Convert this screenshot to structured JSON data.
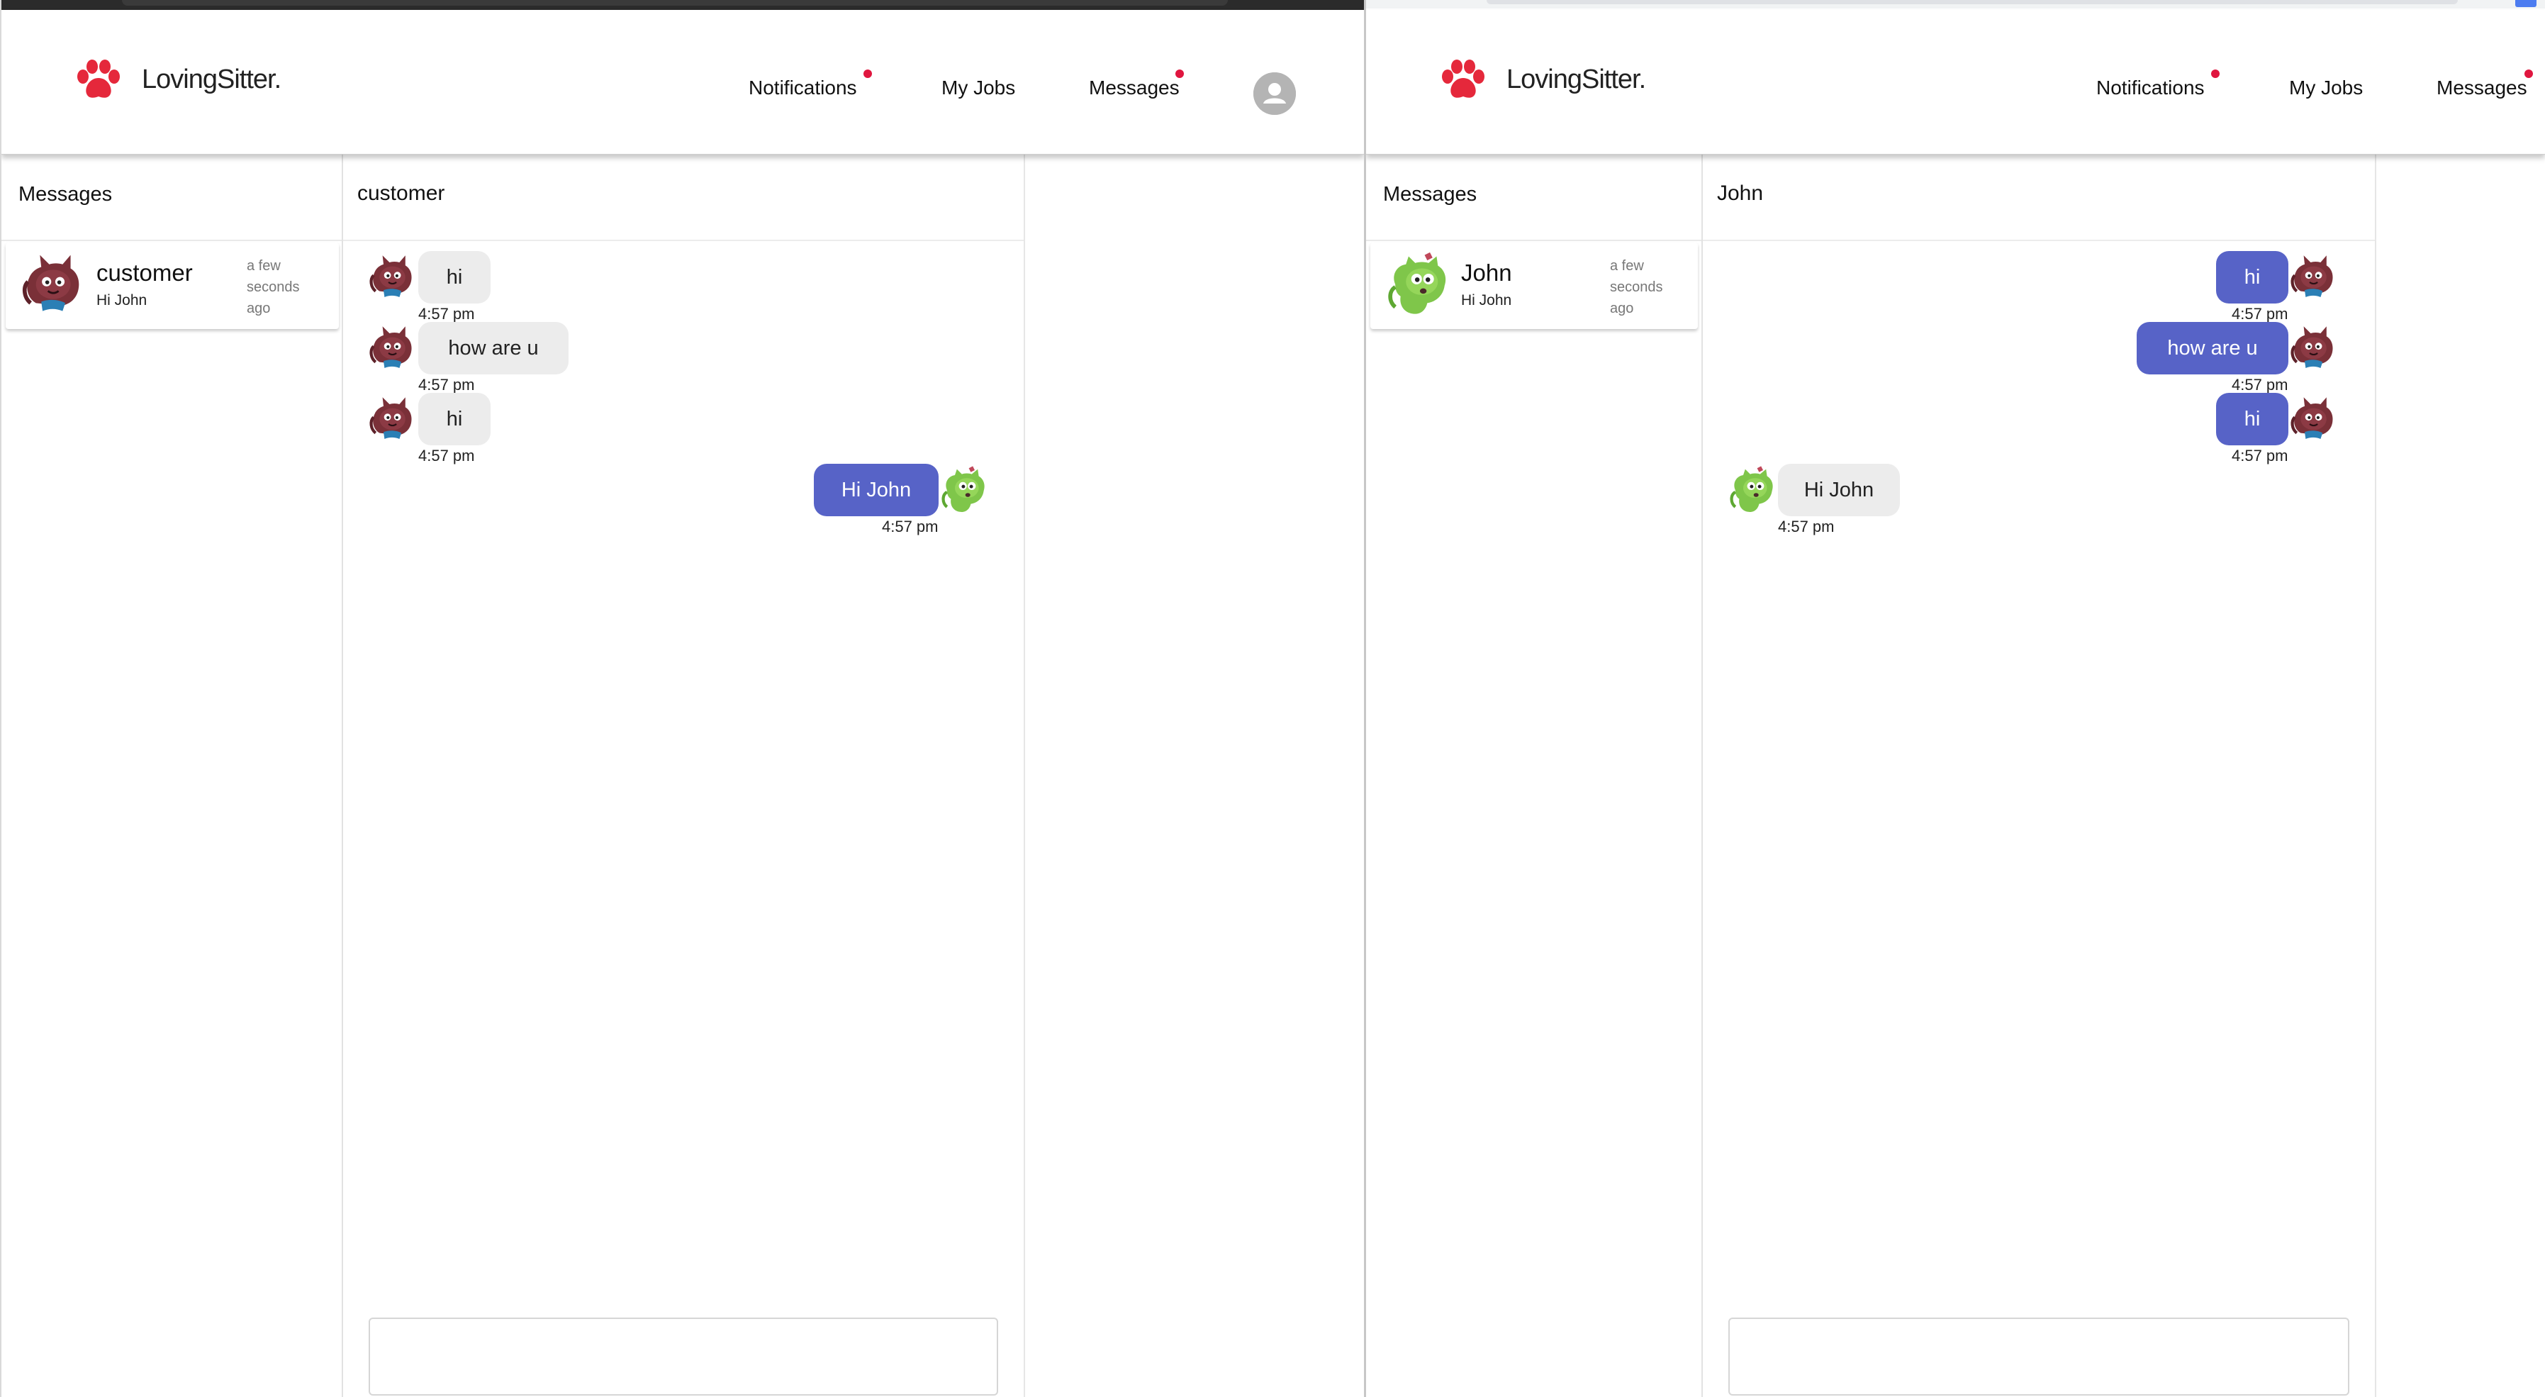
{
  "left_window": {
    "brand": "LovingSitter.",
    "nav": {
      "notifications": "Notifications",
      "my_jobs": "My Jobs",
      "messages": "Messages"
    },
    "sidebar": {
      "title": "Messages",
      "conversation": {
        "name": "customer",
        "preview": "Hi John",
        "time": "a few seconds ago"
      }
    },
    "chat": {
      "title": "customer",
      "messages": [
        {
          "text": "hi",
          "time": "4:57 pm",
          "direction": "incoming"
        },
        {
          "text": "how are u",
          "time": "4:57 pm",
          "direction": "incoming"
        },
        {
          "text": "hi",
          "time": "4:57 pm",
          "direction": "incoming"
        },
        {
          "text": "Hi John",
          "time": "4:57 pm",
          "direction": "outgoing"
        }
      ]
    }
  },
  "right_window": {
    "brand": "LovingSitter.",
    "nav": {
      "notifications": "Notifications",
      "my_jobs": "My Jobs",
      "messages": "Messages"
    },
    "sidebar": {
      "title": "Messages",
      "conversation": {
        "name": "John",
        "preview": "Hi John",
        "time": "a few seconds ago"
      }
    },
    "chat": {
      "title": "John",
      "messages": [
        {
          "text": "hi",
          "time": "4:57 pm",
          "direction": "outgoing"
        },
        {
          "text": "how are u",
          "time": "4:57 pm",
          "direction": "outgoing"
        },
        {
          "text": "hi",
          "time": "4:57 pm",
          "direction": "outgoing"
        },
        {
          "text": "Hi John",
          "time": "4:57 pm",
          "direction": "incoming"
        }
      ]
    }
  },
  "icons": {
    "brand_logo": "paw-icon",
    "notification_dot": "notification-dot",
    "profile": "user-avatar-icon",
    "customer_avatar": "cat-avatar-icon",
    "john_avatar": "green-cat-avatar-icon"
  },
  "colors": {
    "accent": "#5763c7",
    "incoming_bubble": "#ececec",
    "brand_paw": "#e5283b",
    "notification_dot": "#e0163f"
  }
}
